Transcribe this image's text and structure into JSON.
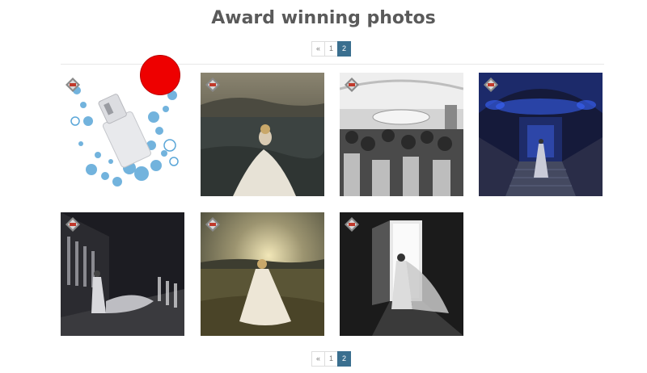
{
  "page": {
    "title": "Award winning photos"
  },
  "pagination": {
    "prev": "«",
    "pages": [
      "1",
      "2"
    ],
    "current": "2"
  },
  "gallery": {
    "photos": [
      {
        "name": "photo-essie-bottle"
      },
      {
        "name": "photo-bride-sea"
      },
      {
        "name": "photo-wedding-dance"
      },
      {
        "name": "photo-blue-staircase"
      },
      {
        "name": "photo-bride-corridor"
      },
      {
        "name": "photo-bride-field"
      },
      {
        "name": "photo-bride-doorway"
      }
    ]
  },
  "icons": {
    "badge": "award-badge-icon",
    "dot": "red-circle"
  },
  "colors": {
    "active_page": "#3a6f8f",
    "marker": "#ee0000"
  }
}
